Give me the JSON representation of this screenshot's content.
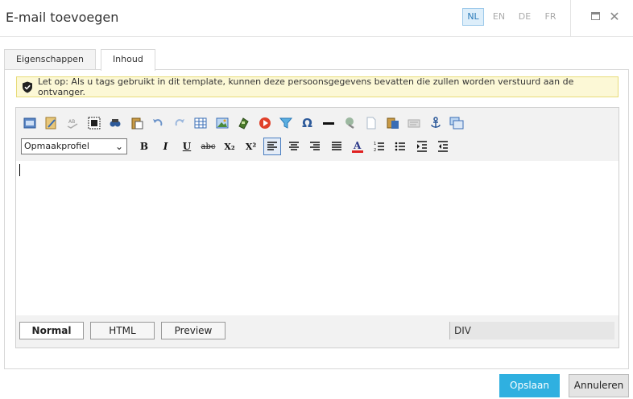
{
  "dialog": {
    "title": "E-mail toevoegen",
    "languages": [
      {
        "code": "NL",
        "active": true
      },
      {
        "code": "EN",
        "active": false
      },
      {
        "code": "DE",
        "active": false
      },
      {
        "code": "FR",
        "active": false
      }
    ],
    "maximize_icon": "maximize-icon",
    "close_icon": "close-icon",
    "close_glyph": "✕"
  },
  "tabs": [
    {
      "label": "Eigenschappen",
      "active": false
    },
    {
      "label": "Inhoud",
      "active": true
    }
  ],
  "warning": {
    "icon": "shield-check-icon",
    "text": "Let op: Als u tags gebruikt in dit template, kunnen deze persoonsgegevens bevatten die zullen worden verstuurd aan de ontvanger."
  },
  "editor": {
    "format_select": {
      "value": "Opmaakprofiel",
      "arrow": "⌄"
    },
    "toolbar_row1": [
      "template-icon",
      "image-manager-icon",
      "spellcheck-icon",
      "select-all-icon",
      "find-replace-icon",
      "paste-icon",
      "undo-icon",
      "redo-icon",
      "table-icon",
      "image-icon",
      "media-icon",
      "flash-icon",
      "filter-icon",
      "omega-symbol-icon",
      "horizontal-rule-icon",
      "hyperlink-icon",
      "new-document-icon",
      "paste-word-icon",
      "paste-text-icon",
      "anchor-icon",
      "formatting-icon"
    ],
    "toolbar_row2": [
      "bold-icon",
      "italic-icon",
      "underline-icon",
      "strikethrough-icon",
      "subscript-icon",
      "superscript-icon",
      "align-left-icon",
      "align-center-icon",
      "align-right-icon",
      "justify-icon",
      "font-color-icon",
      "ordered-list-icon",
      "unordered-list-icon",
      "indent-icon",
      "outdent-icon"
    ],
    "glyphs": {
      "bold": "B",
      "italic": "I",
      "underline": "U",
      "strike": "abc",
      "sub": "X₂",
      "sup": "X²",
      "font_color": "A",
      "omega": "Ω"
    },
    "modes": [
      {
        "label": "Normal",
        "active": true
      },
      {
        "label": "HTML",
        "active": false
      },
      {
        "label": "Preview",
        "active": false
      }
    ],
    "path_label": "DIV"
  },
  "footer": {
    "save_label": "Opslaan",
    "cancel_label": "Annuleren"
  },
  "colors": {
    "primary": "#2fb0e0",
    "warning_bg": "#fcf8d6",
    "active_lang_bg": "#ddeefa"
  }
}
